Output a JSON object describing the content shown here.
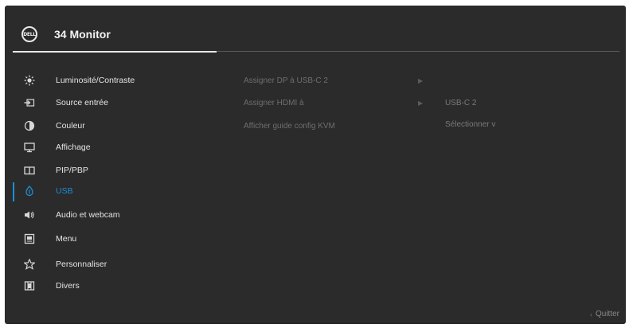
{
  "header": {
    "logo_text": "DELL",
    "title": "34 Monitor"
  },
  "menu": {
    "items": [
      {
        "label": "Luminosité/Contraste",
        "icon": "brightness-icon",
        "active": false
      },
      {
        "label": "Source entrée",
        "icon": "input-source-icon",
        "active": false
      },
      {
        "label": "Couleur",
        "icon": "color-icon",
        "active": false
      },
      {
        "label": "Affichage",
        "icon": "display-icon",
        "active": false
      },
      {
        "label": "PIP/PBP",
        "icon": "pip-pbp-icon",
        "active": false
      },
      {
        "label": "USB",
        "icon": "usb-icon",
        "active": true
      },
      {
        "label": "Audio et webcam",
        "icon": "audio-webcam-icon",
        "active": false
      },
      {
        "label": "Menu",
        "icon": "menu-icon",
        "active": false
      },
      {
        "label": "Personnaliser",
        "icon": "star-icon",
        "active": false
      },
      {
        "label": "Divers",
        "icon": "others-icon",
        "active": false
      }
    ]
  },
  "submenu": {
    "items": [
      {
        "label": "Assigner DP à USB-C 2",
        "has_arrow": true
      },
      {
        "label": "Assigner HDMI à",
        "has_arrow": true
      },
      {
        "label": "Afficher guide config KVM",
        "has_arrow": false
      }
    ]
  },
  "values": {
    "items": [
      {
        "label": "USB-C 2"
      },
      {
        "label": "Sélectionner v"
      }
    ]
  },
  "footer": {
    "quit_label": "Quitter",
    "quit_icon": "back-chevron-icon"
  },
  "colors": {
    "background": "#2b2b2b",
    "accent": "#1b8fd6",
    "text": "#e4e4e4",
    "dim_text": "#6e6e6e"
  }
}
